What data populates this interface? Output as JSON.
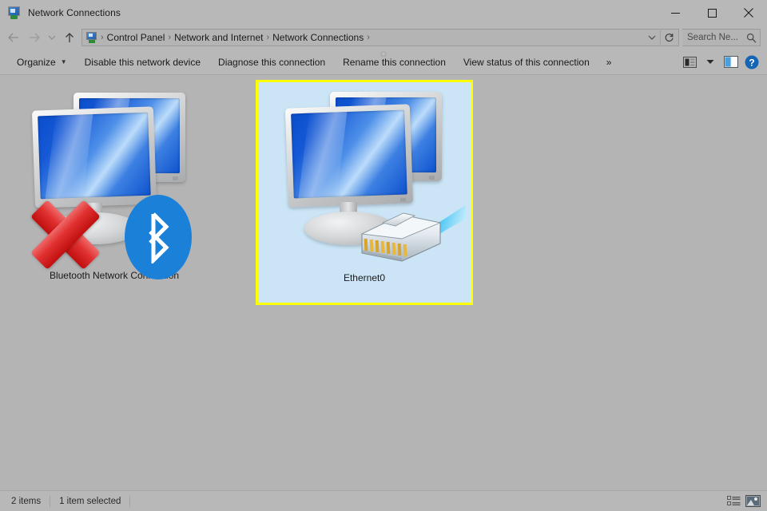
{
  "window": {
    "title": "Network Connections",
    "title_icon": "network-connections-icon",
    "buttons": {
      "minimize": "minimize-button",
      "maximize": "maximize-button",
      "close": "close-button"
    }
  },
  "addressbar": {
    "back": "back-arrow-icon",
    "forward": "forward-arrow-icon",
    "recent": "recent-locations-chevron-icon",
    "up": "up-arrow-icon",
    "path_icon": "network-connections-icon",
    "crumbs": [
      "Control Panel",
      "Network and Internet",
      "Network Connections"
    ],
    "separator": "›",
    "dropdown": "address-dropdown-icon",
    "refresh": "refresh-icon",
    "search": {
      "value": "Search Ne...",
      "placeholder": "Search Network Connections",
      "icon": "search-icon"
    }
  },
  "toolbar": {
    "organize": "Organize",
    "organize_caret": "▼",
    "items": [
      "Disable this network device",
      "Diagnose this connection",
      "Rename this connection",
      "View status of this connection"
    ],
    "overflow": "»",
    "view_icon": "change-view-icon",
    "view_caret": "▼",
    "preview_pane_icon": "preview-pane-icon",
    "help_icon": "help-icon",
    "help_glyph": "?"
  },
  "connections": [
    {
      "name": "Bluetooth Network Connection",
      "selected": false,
      "icon": "two-monitors-icon",
      "badges": [
        "red-x-disconnected-icon",
        "bluetooth-icon"
      ]
    },
    {
      "name": "Ethernet0",
      "selected": true,
      "icon": "two-monitors-icon",
      "badges": [
        "rj45-ethernet-cable-icon"
      ]
    }
  ],
  "statusbar": {
    "item_count": "2 items",
    "selection": "1 item selected",
    "views": [
      "details-view-icon",
      "large-icons-view-icon"
    ]
  },
  "colors": {
    "chrome": "#b8b8b8",
    "content_bg": "#b4b4b4",
    "selection_border": "#ffff00",
    "selection_fill": "#cbe5f7",
    "accent_blue": "#1b81d8",
    "screen_blue": "#0b4ecb",
    "disconnect_red": "#d01e1e",
    "text": "#1a1a1a"
  }
}
